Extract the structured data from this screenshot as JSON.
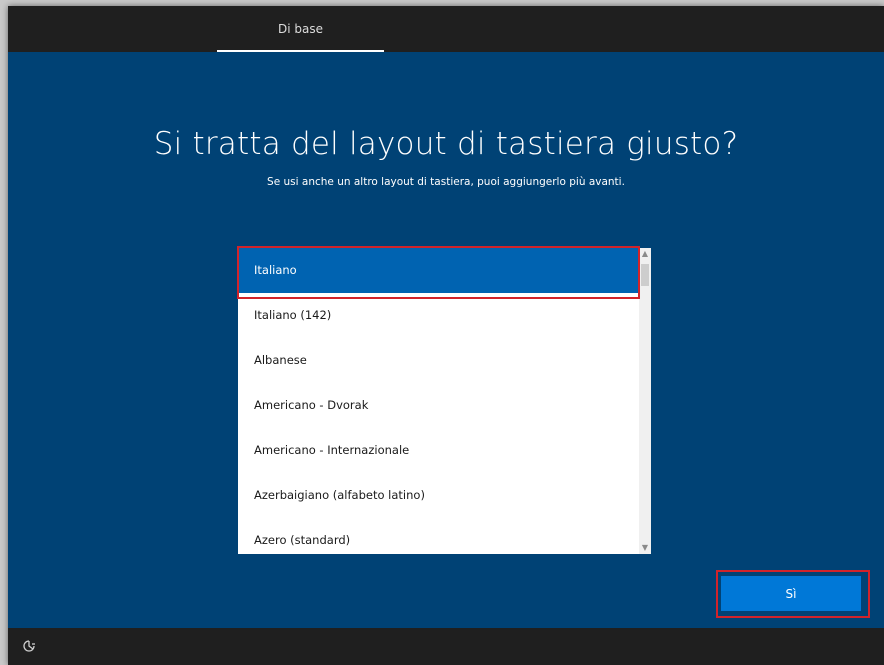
{
  "header": {
    "tab_label": "Di base"
  },
  "main": {
    "title": "Si tratta del layout di tastiera giusto?",
    "subtitle": "Se usi anche un altro layout di tastiera, puoi aggiungerlo più avanti."
  },
  "keyboard_list": {
    "selected_index": 0,
    "items": [
      {
        "label": "Italiano"
      },
      {
        "label": "Italiano (142)"
      },
      {
        "label": "Albanese"
      },
      {
        "label": "Americano - Dvorak"
      },
      {
        "label": "Americano - Internazionale"
      },
      {
        "label": "Azerbaigiano (alfabeto latino)"
      },
      {
        "label": "Azero (standard)"
      }
    ]
  },
  "actions": {
    "yes_label": "Sì"
  },
  "footer": {
    "icon": "accessibility-icon"
  },
  "colors": {
    "accent": "#0078d7",
    "selected": "#0063b1",
    "background": "#004275",
    "highlight_outline": "#d1232a"
  }
}
